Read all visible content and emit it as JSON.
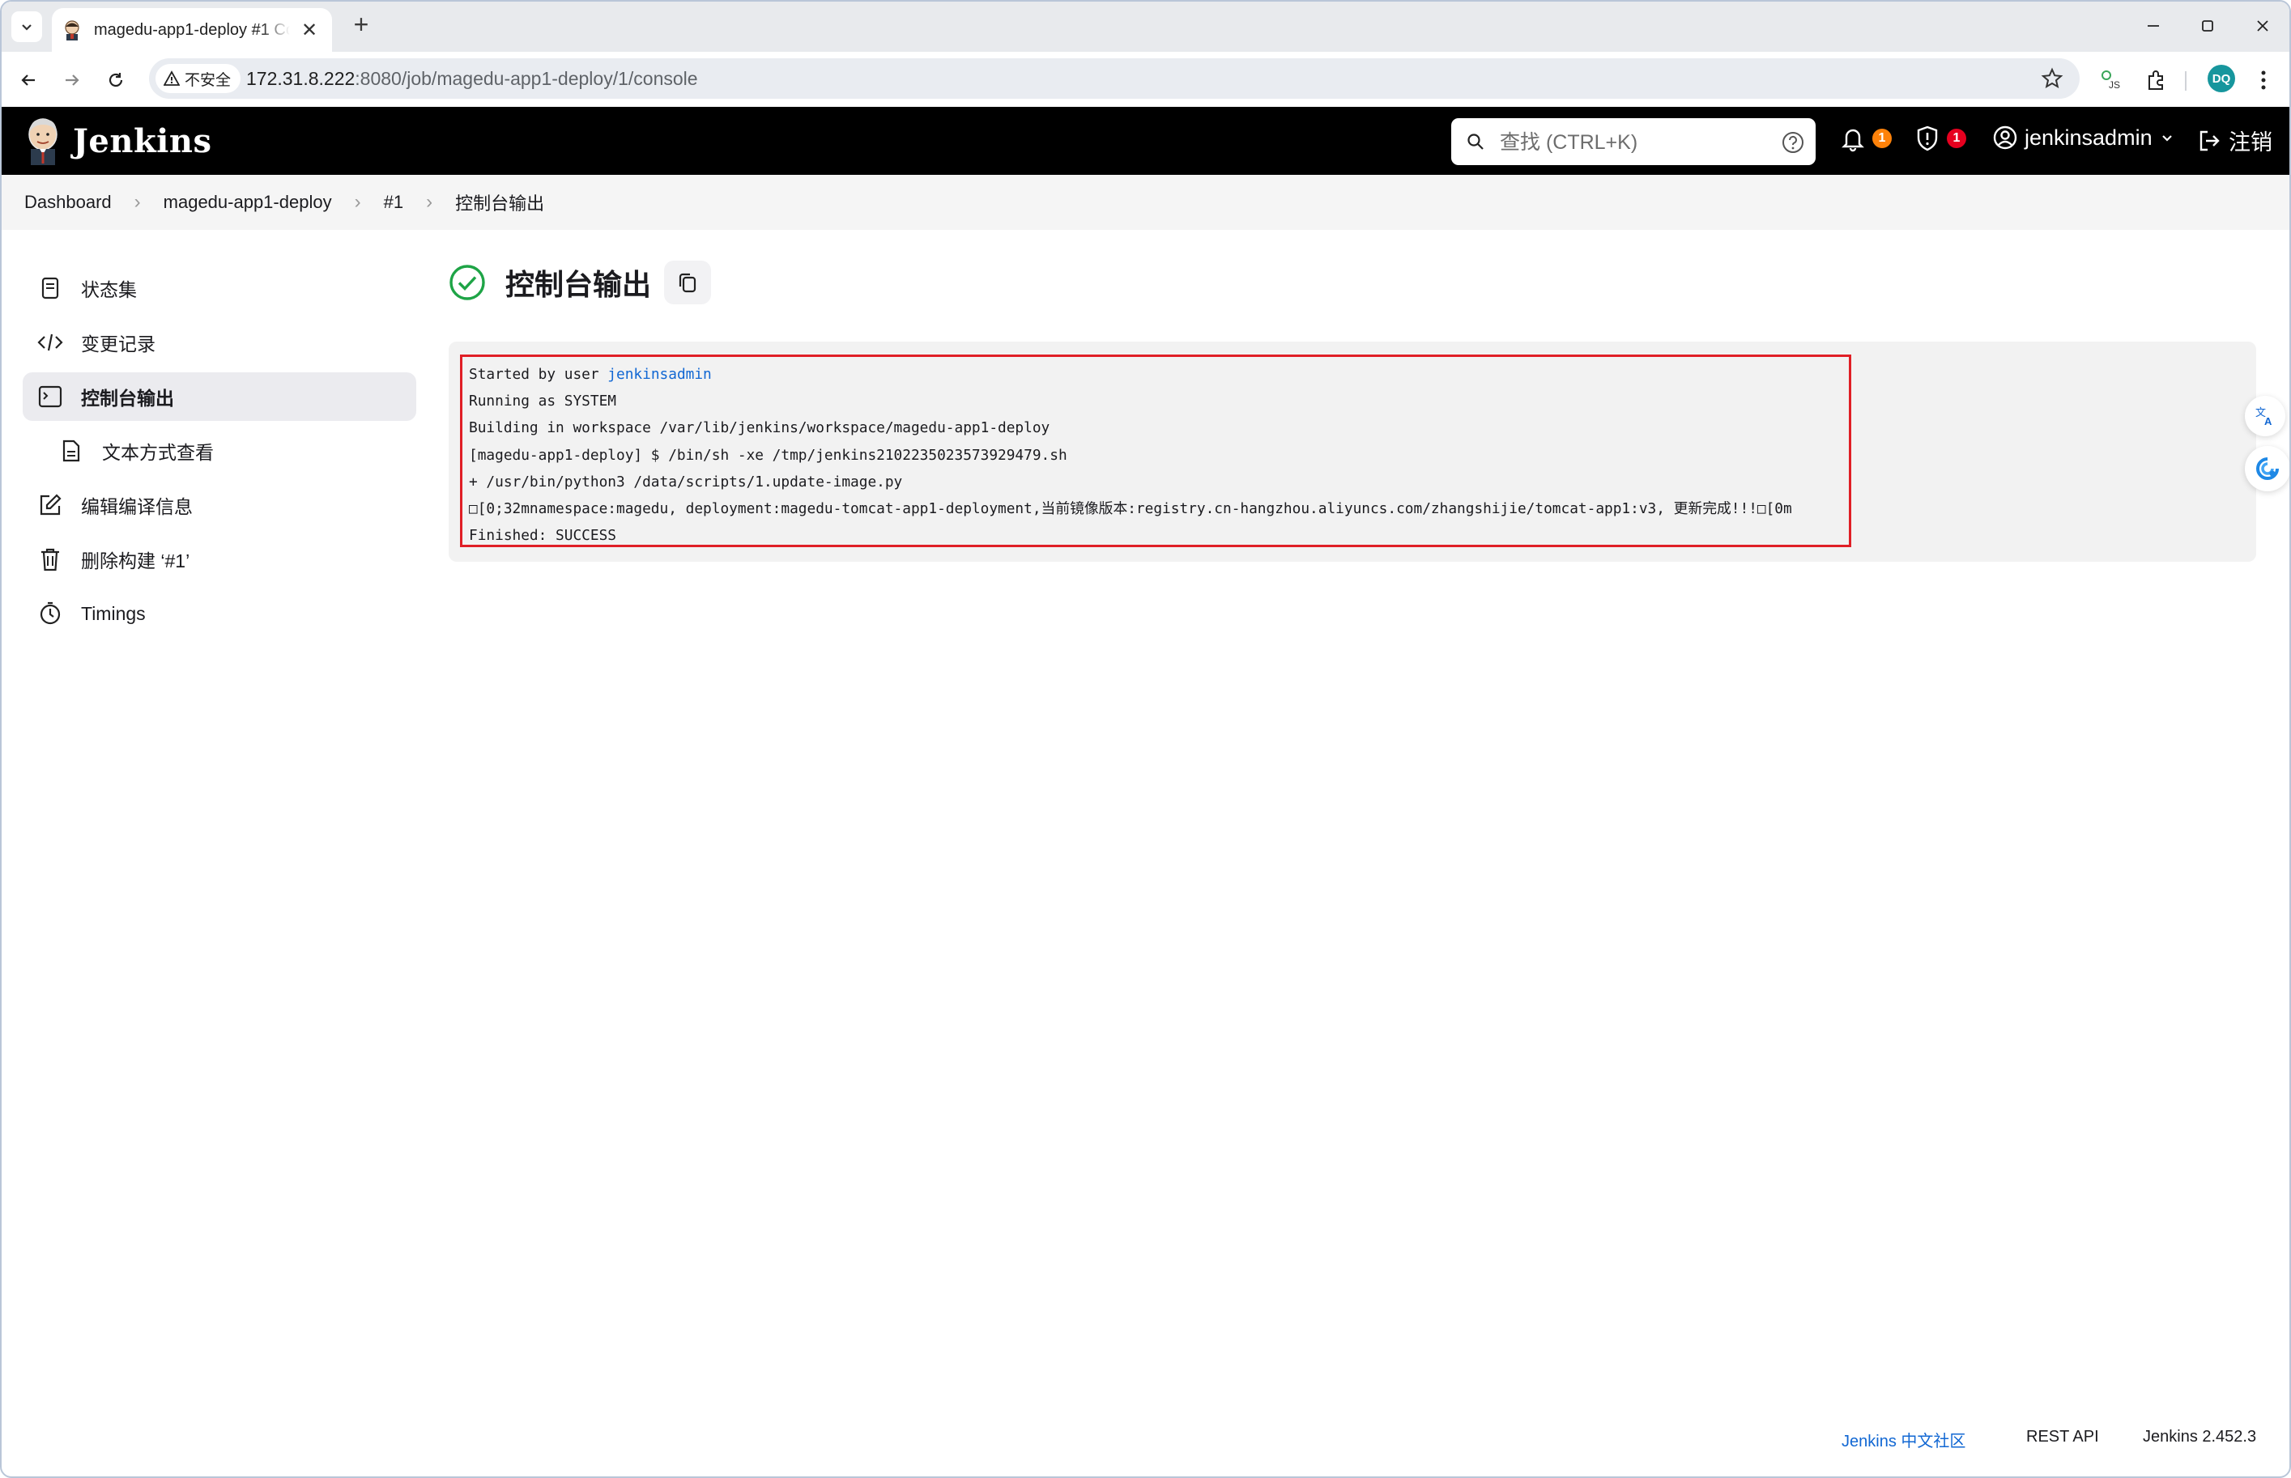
{
  "browser": {
    "tab_title": "magedu-app1-deploy #1 Console",
    "security_label": "不安全",
    "url_host": "172.31.8.222",
    "url_rest": ":8080/job/magedu-app1-deploy/1/console",
    "profile_initials": "DQ"
  },
  "header": {
    "brand": "Jenkins",
    "search_placeholder": "查找 (CTRL+K)",
    "notifications_count": "1",
    "security_count": "1",
    "username": "jenkinsadmin",
    "logout_label": "注销"
  },
  "breadcrumb": [
    "Dashboard",
    "magedu-app1-deploy",
    "#1",
    "控制台输出"
  ],
  "sidebar": {
    "items": [
      {
        "label": "状态集",
        "icon": "notepad-icon"
      },
      {
        "label": "变更记录",
        "icon": "code-icon"
      },
      {
        "label": "控制台输出",
        "icon": "terminal-icon"
      },
      {
        "label": "文本方式查看",
        "icon": "document-icon"
      },
      {
        "label": "编辑编译信息",
        "icon": "edit-icon"
      },
      {
        "label": "删除构建 ‘#1’",
        "icon": "trash-icon"
      },
      {
        "label": "Timings",
        "icon": "timer-icon"
      }
    ]
  },
  "main": {
    "title": "控制台输出",
    "console": {
      "line1_prefix": "Started by user ",
      "line1_user": "jenkinsadmin",
      "line2": "Running as SYSTEM",
      "line3": "Building in workspace /var/lib/jenkins/workspace/magedu-app1-deploy",
      "line4": "[magedu-app1-deploy] $ /bin/sh -xe /tmp/jenkins2102235023573929479.sh",
      "line5": "+ /usr/bin/python3 /data/scripts/1.update-image.py",
      "line6": "□[0;32mnamespace:magedu, deployment:magedu-tomcat-app1-deployment,当前镜像版本:registry.cn-hangzhou.aliyuncs.com/zhangshijie/tomcat-app1:v3, 更新完成!!!□[0m",
      "line7": "Finished: SUCCESS"
    }
  },
  "footer": {
    "community_link": "Jenkins 中文社区",
    "rest_api": "REST API",
    "version": "Jenkins 2.452.3"
  },
  "colors": {
    "success": "#1ea446",
    "link": "#1167d3",
    "highlight_border": "#e01f26",
    "badge_orange": "#fe820a",
    "badge_red": "#e6001f"
  }
}
